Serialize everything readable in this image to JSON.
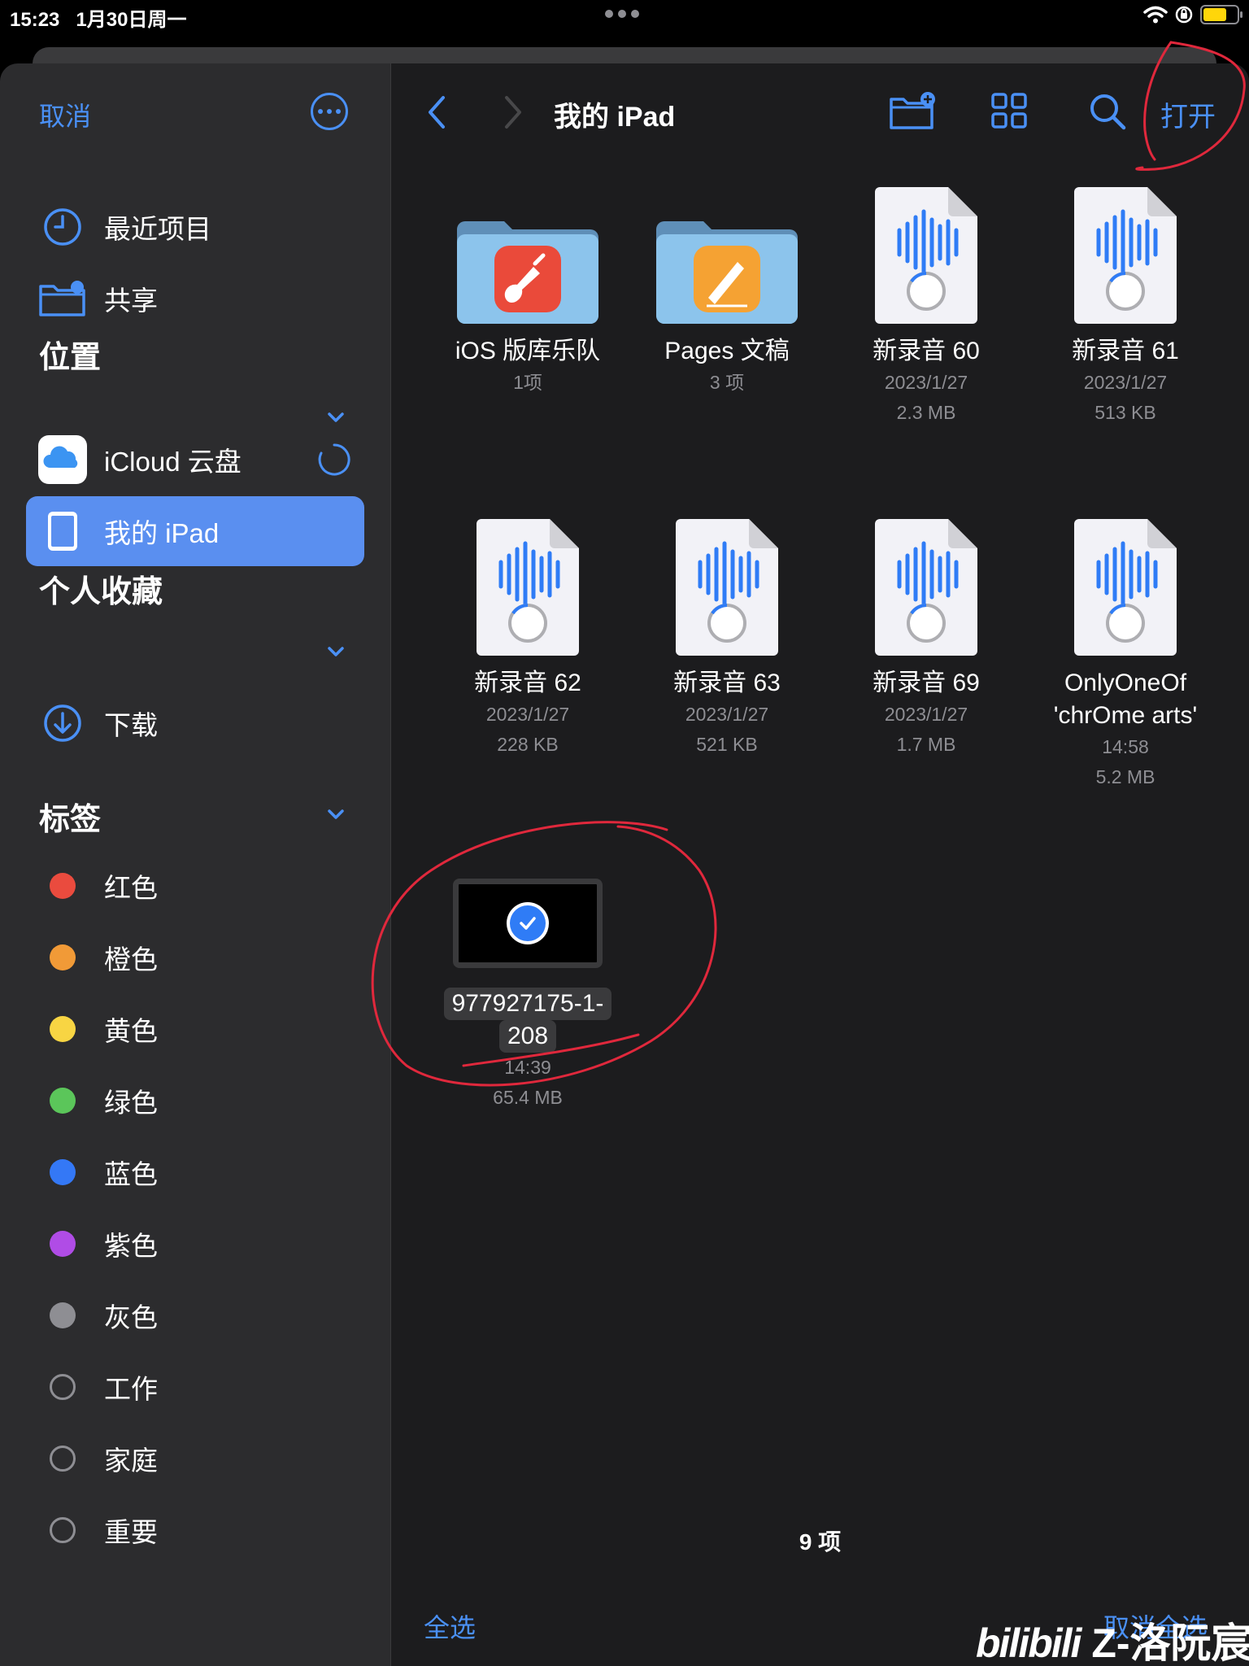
{
  "status": {
    "time": "15:23",
    "date": "1月30日周一"
  },
  "sidebar": {
    "cancel": "取消",
    "recents": "最近项目",
    "shared": "共享",
    "locations_title": "位置",
    "icloud": "iCloud 云盘",
    "my_ipad": "我的 iPad",
    "favorites_title": "个人收藏",
    "downloads": "下载",
    "tags_title": "标签",
    "tags": [
      {
        "label": "红色",
        "color": "#ea4b3e"
      },
      {
        "label": "橙色",
        "color": "#f19a37"
      },
      {
        "label": "黄色",
        "color": "#f8d543"
      },
      {
        "label": "绿色",
        "color": "#5bc65a"
      },
      {
        "label": "蓝色",
        "color": "#3478f6"
      },
      {
        "label": "紫色",
        "color": "#b04ce6"
      },
      {
        "label": "灰色",
        "color": "#8e8e93"
      },
      {
        "label": "工作",
        "color": ""
      },
      {
        "label": "家庭",
        "color": ""
      },
      {
        "label": "重要",
        "color": ""
      }
    ]
  },
  "toolbar": {
    "title": "我的 iPad",
    "open": "打开"
  },
  "files": [
    {
      "name": "iOS 版库乐队",
      "meta1": "1项",
      "meta2": "",
      "kind": "folder-garageband"
    },
    {
      "name": "Pages 文稿",
      "meta1": "3 项",
      "meta2": "",
      "kind": "folder-pages"
    },
    {
      "name": "新录音 60",
      "meta1": "2023/1/27",
      "meta2": "2.3 MB",
      "kind": "audio"
    },
    {
      "name": "新录音 61",
      "meta1": "2023/1/27",
      "meta2": "513 KB",
      "kind": "audio"
    },
    {
      "name": "新录音 62",
      "meta1": "2023/1/27",
      "meta2": "228 KB",
      "kind": "audio"
    },
    {
      "name": "新录音 63",
      "meta1": "2023/1/27",
      "meta2": "521 KB",
      "kind": "audio"
    },
    {
      "name": "新录音 69",
      "meta1": "2023/1/27",
      "meta2": "1.7 MB",
      "kind": "audio"
    },
    {
      "name": "OnlyOneOf 'chrOme arts'",
      "meta1": "14:58",
      "meta2": "5.2 MB",
      "kind": "audio"
    },
    {
      "name": "977927175-1-208",
      "meta1": "14:39",
      "meta2": "65.4 MB",
      "kind": "video"
    }
  ],
  "selected": {
    "name_line1": "977927175-1-",
    "name_line2": "208"
  },
  "footer": {
    "count": "9 项",
    "select_all": "全选",
    "deselect_all": "取消全选"
  },
  "watermark": {
    "logo": "bilibili",
    "author": "Z-洛阮宸"
  },
  "colors": {
    "accent": "#4a90f5",
    "sidebar_bg": "#2c2c2e",
    "main_bg": "#1c1c1e",
    "selected_bg": "#5a8ff0",
    "annotation": "#e0283c"
  }
}
